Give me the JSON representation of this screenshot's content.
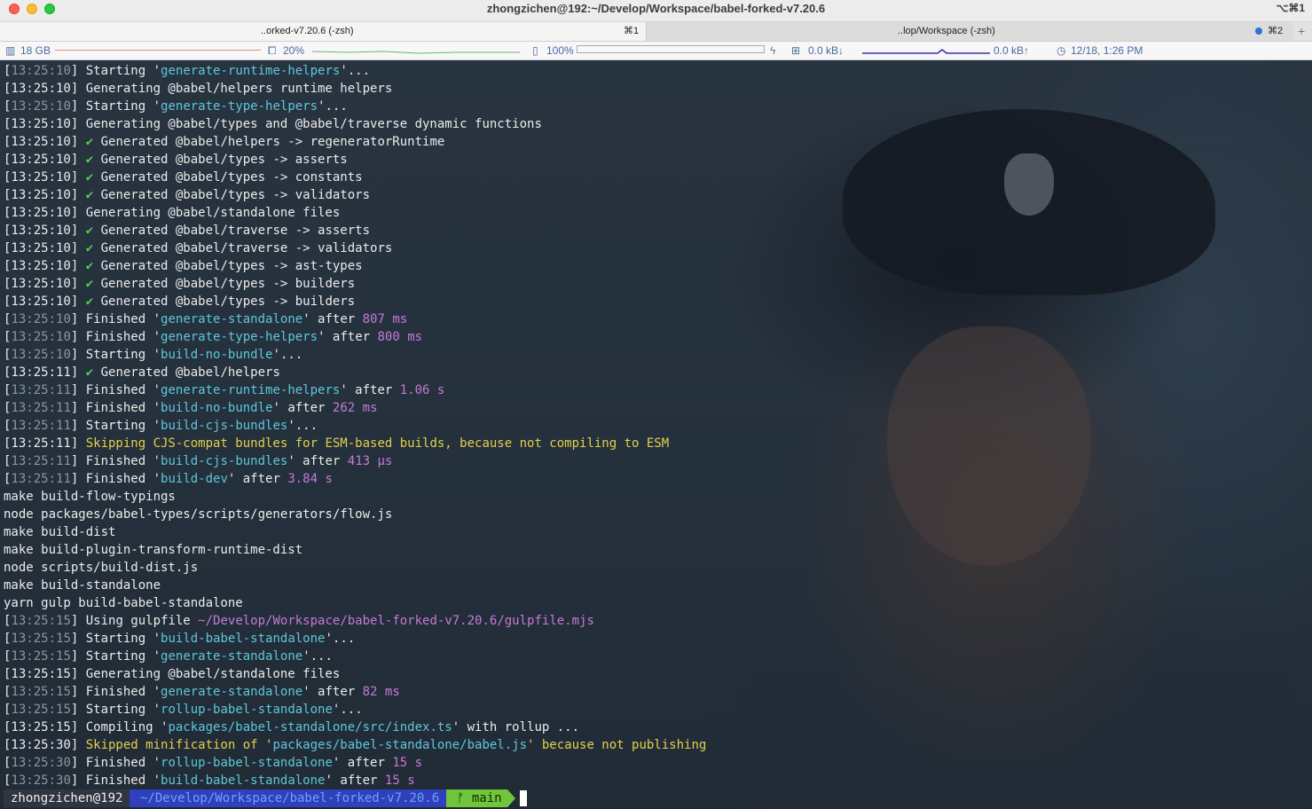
{
  "window": {
    "title": "zhongzichen@192:~/Develop/Workspace/babel-forked-v7.20.6",
    "shortcut": "⌥⌘1"
  },
  "tabs": [
    {
      "label": "..orked-v7.20.6 (-zsh)",
      "shortcut": "⌘1",
      "active": true
    },
    {
      "label": "..lop/Workspace (-zsh)",
      "shortcut": "⌘2",
      "active": false
    }
  ],
  "tab_add_label": "+",
  "status": {
    "memory": "18 GB",
    "cpu": "20%",
    "battery": "100%",
    "net_down": "0.0 kB↓",
    "net_up": "0.0 kB↑",
    "clock": "12/18, 1:26 PM"
  },
  "lines": [
    [
      [
        "[",
        "w"
      ],
      [
        "13:25:10",
        "d"
      ],
      [
        "] Starting '",
        "w"
      ],
      [
        "generate-runtime-helpers",
        "c"
      ],
      [
        "'...",
        "w"
      ]
    ],
    [
      [
        "[13:25:10] Generating @babel/helpers runtime helpers",
        "w"
      ]
    ],
    [
      [
        "[",
        "w"
      ],
      [
        "13:25:10",
        "d"
      ],
      [
        "] Starting '",
        "w"
      ],
      [
        "generate-type-helpers",
        "c"
      ],
      [
        "'...",
        "w"
      ]
    ],
    [
      [
        "[13:25:10] Generating @babel/types and @babel/traverse dynamic functions",
        "w"
      ]
    ],
    [
      [
        "[13:25:10] ",
        "w"
      ],
      [
        "✔",
        "g"
      ],
      [
        " Generated @babel/helpers -> regeneratorRuntime",
        "w"
      ]
    ],
    [
      [
        "[13:25:10] ",
        "w"
      ],
      [
        "✔",
        "g"
      ],
      [
        " Generated @babel/types -> asserts",
        "w"
      ]
    ],
    [
      [
        "[13:25:10] ",
        "w"
      ],
      [
        "✔",
        "g"
      ],
      [
        " Generated @babel/types -> constants",
        "w"
      ]
    ],
    [
      [
        "[13:25:10] ",
        "w"
      ],
      [
        "✔",
        "g"
      ],
      [
        " Generated @babel/types -> validators",
        "w"
      ]
    ],
    [
      [
        "[13:25:10] Generating @babel/standalone files",
        "w"
      ]
    ],
    [
      [
        "[13:25:10] ",
        "w"
      ],
      [
        "✔",
        "g"
      ],
      [
        " Generated @babel/traverse -> asserts",
        "w"
      ]
    ],
    [
      [
        "[13:25:10] ",
        "w"
      ],
      [
        "✔",
        "g"
      ],
      [
        " Generated @babel/traverse -> validators",
        "w"
      ]
    ],
    [
      [
        "[13:25:10] ",
        "w"
      ],
      [
        "✔",
        "g"
      ],
      [
        " Generated @babel/types -> ast-types",
        "w"
      ]
    ],
    [
      [
        "[13:25:10] ",
        "w"
      ],
      [
        "✔",
        "g"
      ],
      [
        " Generated @babel/types -> builders",
        "w"
      ]
    ],
    [
      [
        "[13:25:10] ",
        "w"
      ],
      [
        "✔",
        "g"
      ],
      [
        " Generated @babel/types -> builders",
        "w"
      ]
    ],
    [
      [
        "[",
        "w"
      ],
      [
        "13:25:10",
        "d"
      ],
      [
        "] Finished '",
        "w"
      ],
      [
        "generate-standalone",
        "c"
      ],
      [
        "' after ",
        "w"
      ],
      [
        "807 ms",
        "m"
      ]
    ],
    [
      [
        "[",
        "w"
      ],
      [
        "13:25:10",
        "d"
      ],
      [
        "] Finished '",
        "w"
      ],
      [
        "generate-type-helpers",
        "c"
      ],
      [
        "' after ",
        "w"
      ],
      [
        "800 ms",
        "m"
      ]
    ],
    [
      [
        "[",
        "w"
      ],
      [
        "13:25:10",
        "d"
      ],
      [
        "] Starting '",
        "w"
      ],
      [
        "build-no-bundle",
        "c"
      ],
      [
        "'...",
        "w"
      ]
    ],
    [
      [
        "[13:25:11] ",
        "w"
      ],
      [
        "✔",
        "g"
      ],
      [
        " Generated @babel/helpers",
        "w"
      ]
    ],
    [
      [
        "[",
        "w"
      ],
      [
        "13:25:11",
        "d"
      ],
      [
        "] Finished '",
        "w"
      ],
      [
        "generate-runtime-helpers",
        "c"
      ],
      [
        "' after ",
        "w"
      ],
      [
        "1.06 s",
        "m"
      ]
    ],
    [
      [
        "[",
        "w"
      ],
      [
        "13:25:11",
        "d"
      ],
      [
        "] Finished '",
        "w"
      ],
      [
        "build-no-bundle",
        "c"
      ],
      [
        "' after ",
        "w"
      ],
      [
        "262 ms",
        "m"
      ]
    ],
    [
      [
        "[",
        "w"
      ],
      [
        "13:25:11",
        "d"
      ],
      [
        "] Starting '",
        "w"
      ],
      [
        "build-cjs-bundles",
        "c"
      ],
      [
        "'...",
        "w"
      ]
    ],
    [
      [
        "[13:25:11] ",
        "w"
      ],
      [
        "Skipping CJS-compat bundles for ESM-based builds, because not compiling to ESM",
        "y"
      ]
    ],
    [
      [
        "[",
        "w"
      ],
      [
        "13:25:11",
        "d"
      ],
      [
        "] Finished '",
        "w"
      ],
      [
        "build-cjs-bundles",
        "c"
      ],
      [
        "' after ",
        "w"
      ],
      [
        "413 μs",
        "m"
      ]
    ],
    [
      [
        "[",
        "w"
      ],
      [
        "13:25:11",
        "d"
      ],
      [
        "] Finished '",
        "w"
      ],
      [
        "build-dev",
        "c"
      ],
      [
        "' after ",
        "w"
      ],
      [
        "3.84 s",
        "m"
      ]
    ],
    [
      [
        "make build-flow-typings",
        "w"
      ]
    ],
    [
      [
        "node packages/babel-types/scripts/generators/flow.js",
        "w"
      ]
    ],
    [
      [
        "make build-dist",
        "w"
      ]
    ],
    [
      [
        "make build-plugin-transform-runtime-dist",
        "w"
      ]
    ],
    [
      [
        "node scripts/build-dist.js",
        "w"
      ]
    ],
    [
      [
        "make build-standalone",
        "w"
      ]
    ],
    [
      [
        "yarn gulp build-babel-standalone",
        "w"
      ]
    ],
    [
      [
        "[",
        "w"
      ],
      [
        "13:25:15",
        "d"
      ],
      [
        "] Using gulpfile ",
        "w"
      ],
      [
        "~/Develop/Workspace/babel-forked-v7.20.6/gulpfile.mjs",
        "m"
      ]
    ],
    [
      [
        "[",
        "w"
      ],
      [
        "13:25:15",
        "d"
      ],
      [
        "] Starting '",
        "w"
      ],
      [
        "build-babel-standalone",
        "c"
      ],
      [
        "'...",
        "w"
      ]
    ],
    [
      [
        "[",
        "w"
      ],
      [
        "13:25:15",
        "d"
      ],
      [
        "] Starting '",
        "w"
      ],
      [
        "generate-standalone",
        "c"
      ],
      [
        "'...",
        "w"
      ]
    ],
    [
      [
        "[13:25:15] Generating @babel/standalone files",
        "w"
      ]
    ],
    [
      [
        "[",
        "w"
      ],
      [
        "13:25:15",
        "d"
      ],
      [
        "] Finished '",
        "w"
      ],
      [
        "generate-standalone",
        "c"
      ],
      [
        "' after ",
        "w"
      ],
      [
        "82 ms",
        "m"
      ]
    ],
    [
      [
        "[",
        "w"
      ],
      [
        "13:25:15",
        "d"
      ],
      [
        "] Starting '",
        "w"
      ],
      [
        "rollup-babel-standalone",
        "c"
      ],
      [
        "'...",
        "w"
      ]
    ],
    [
      [
        "[13:25:15] Compiling '",
        "w"
      ],
      [
        "packages/babel-standalone/src/index.ts",
        "c"
      ],
      [
        "' with rollup ...",
        "w"
      ]
    ],
    [
      [
        "[13:25:30] ",
        "w"
      ],
      [
        "Skipped minification of '",
        "y"
      ],
      [
        "packages/babel-standalone/babel.js",
        "c"
      ],
      [
        "' because not publishing",
        "y"
      ]
    ],
    [
      [
        "[",
        "w"
      ],
      [
        "13:25:30",
        "d"
      ],
      [
        "] Finished '",
        "w"
      ],
      [
        "rollup-babel-standalone",
        "c"
      ],
      [
        "' after ",
        "w"
      ],
      [
        "15 s",
        "m"
      ]
    ],
    [
      [
        "[",
        "w"
      ],
      [
        "13:25:30",
        "d"
      ],
      [
        "] Finished '",
        "w"
      ],
      [
        "build-babel-standalone",
        "c"
      ],
      [
        "' after ",
        "w"
      ],
      [
        "15 s",
        "m"
      ]
    ]
  ],
  "prompt": {
    "user": "zhongzichen@192",
    "path": "~/Develop/Workspace/babel-forked-v7.20.6",
    "branch_icon": "ᚠ",
    "branch": "main"
  },
  "colors": {
    "w": "#ececec",
    "d": "#8b95a4",
    "c": "#5fc7d8",
    "m": "#c67ad6",
    "g": "#55d04a",
    "y": "#e3d04a"
  }
}
